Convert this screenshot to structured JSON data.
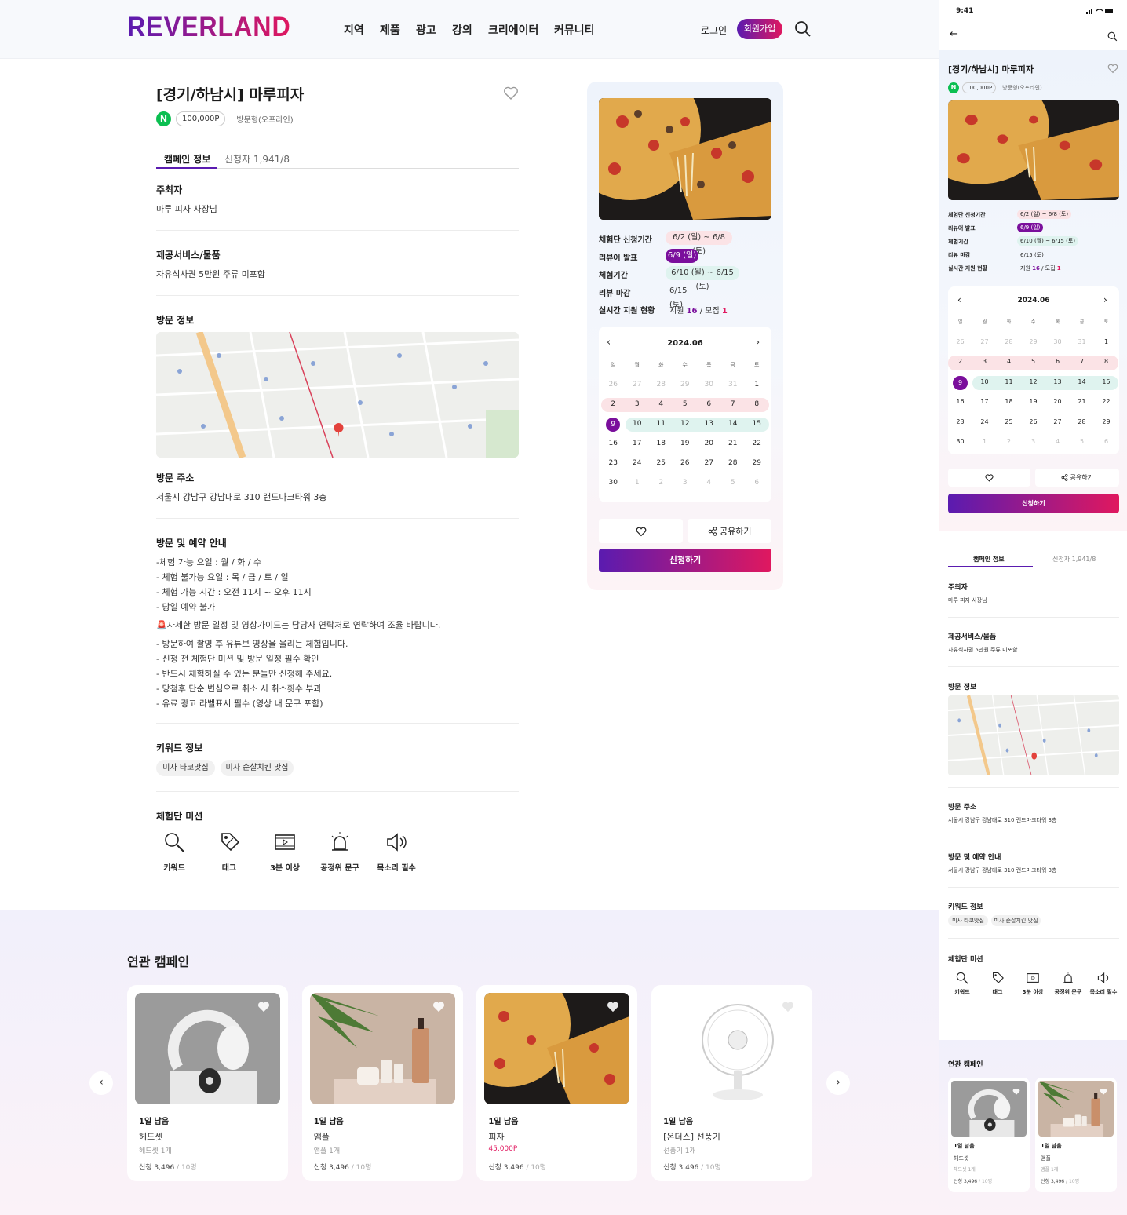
{
  "brand": {
    "logo": "REVERLAND",
    "gradient": [
      "#5a1bb0",
      "#e0185f"
    ]
  },
  "header": {
    "nav": [
      "지역",
      "제품",
      "광고",
      "강의",
      "크리에이터",
      "커뮤니티"
    ],
    "login": "로그인",
    "signup": "회원가입"
  },
  "campaign": {
    "title": "[경기/하남시] 마루피자",
    "platform_badge": "N",
    "points": "100,000P",
    "visit_type": "방문형(오프라인)",
    "tabs": [
      "캠페인 정보",
      "신청자 1,941/8"
    ],
    "host_label": "주최자",
    "host": "마루 피자 사장님",
    "service_label": "제공서비스/물품",
    "service": "자유식사권 5만원 주류 미포함",
    "visit_info_label": "방문 정보",
    "address_label": "방문 주소",
    "address": "서울시 강남구 강남대로 310 랜드마크타워 3층",
    "guide_label": "방문 및 예약 안내",
    "guide_lines": [
      "-체험 가능 요일 : 월 / 화 / 수",
      "- 체험 불가능 요일 : 목 / 금 / 토 / 일",
      "- 체험 가능 시간 : 오전 11시 ~ 오후 11시",
      "- 당일 예약 불가",
      "🚨자세한 방문 일정 및 영상가이드는 담당자 연락처로 연락하여 조율 바랍니다.",
      "- 방문하여 촬영 후 유튜브 영상을 올리는 체험입니다.",
      "- 신청 전 체험단 미션 및 방문 일정 필수 확인",
      "- 반드시 체험하실 수 있는 분들만 신청해 주세요.",
      "- 당첨후 단순 변심으로 취소 시 취소횟수 부과",
      "- 유료 광고 라벨표시 필수 (영상 내 문구 포함)"
    ],
    "keyword_label": "키워드 정보",
    "keywords": [
      "미사 타코맛집",
      "미사 순살치킨 맛집"
    ],
    "mission_label": "체험단 미션",
    "missions": [
      {
        "icon": "search-icon",
        "label": "키워드"
      },
      {
        "icon": "tag-icon",
        "label": "태그"
      },
      {
        "icon": "video-icon",
        "label": "3분 이상"
      },
      {
        "icon": "siren-icon",
        "label": "공정위 문구"
      },
      {
        "icon": "speaker-icon",
        "label": "목소리 필수"
      }
    ]
  },
  "schedule": {
    "rows": [
      {
        "label": "체험단 신청기간",
        "value": "6/2 (일) ~ 6/8 (토)"
      },
      {
        "label": "리뷰어 발표",
        "value": "6/9 (일)"
      },
      {
        "label": "체험기간",
        "value": "6/10 (월) ~ 6/15 (토)"
      },
      {
        "label": "리뷰 마감",
        "value": "6/15 (토)"
      }
    ],
    "live_label": "실시간 지원 현황",
    "live_prefix": "지원 ",
    "applicants": "16",
    "live_mid": " / 모집 ",
    "recruits": "1"
  },
  "calendar": {
    "month": "2024.06",
    "weekdays": [
      "일",
      "월",
      "화",
      "수",
      "목",
      "금",
      "토"
    ],
    "weeks": [
      [
        "26",
        "27",
        "28",
        "29",
        "30",
        "31",
        "1"
      ],
      [
        "2",
        "3",
        "4",
        "5",
        "6",
        "7",
        "8"
      ],
      [
        "9",
        "10",
        "11",
        "12",
        "13",
        "14",
        "15"
      ],
      [
        "16",
        "17",
        "18",
        "19",
        "20",
        "21",
        "22"
      ],
      [
        "23",
        "24",
        "25",
        "26",
        "27",
        "28",
        "29"
      ],
      [
        "30",
        "1",
        "2",
        "3",
        "4",
        "5",
        "6"
      ]
    ],
    "colors": {
      "apply": "#fbe3e6",
      "announce": "#7a0f9c",
      "experience": "#dff3ef"
    }
  },
  "actions": {
    "share": "공유하기",
    "apply": "신청하기"
  },
  "related": {
    "title": "연관 캠페인",
    "items": [
      {
        "days": "1일 남음",
        "name": "헤드셋",
        "sub": "헤드셋 1개",
        "count": "신청 3,496",
        "total": " / 10명",
        "img": "headset"
      },
      {
        "days": "1일 남음",
        "name": "앰플",
        "sub": "앰플 1개",
        "count": "신청 3,496",
        "total": " / 10명",
        "img": "ampoule"
      },
      {
        "days": "1일 남음",
        "name": "피자",
        "sub": "45,000P",
        "count": "신청 3,496",
        "total": " / 10명",
        "img": "pizza"
      },
      {
        "days": "1일 남음",
        "name": "[온더스] 선풍기",
        "sub": "선풍기 1개",
        "count": "신청 3,496",
        "total": " / 10명",
        "img": "fan"
      }
    ]
  },
  "mobile": {
    "time": "9:41",
    "guide_text": "서울시 강남구 강남대로 310 랜드마크타워 3층"
  }
}
